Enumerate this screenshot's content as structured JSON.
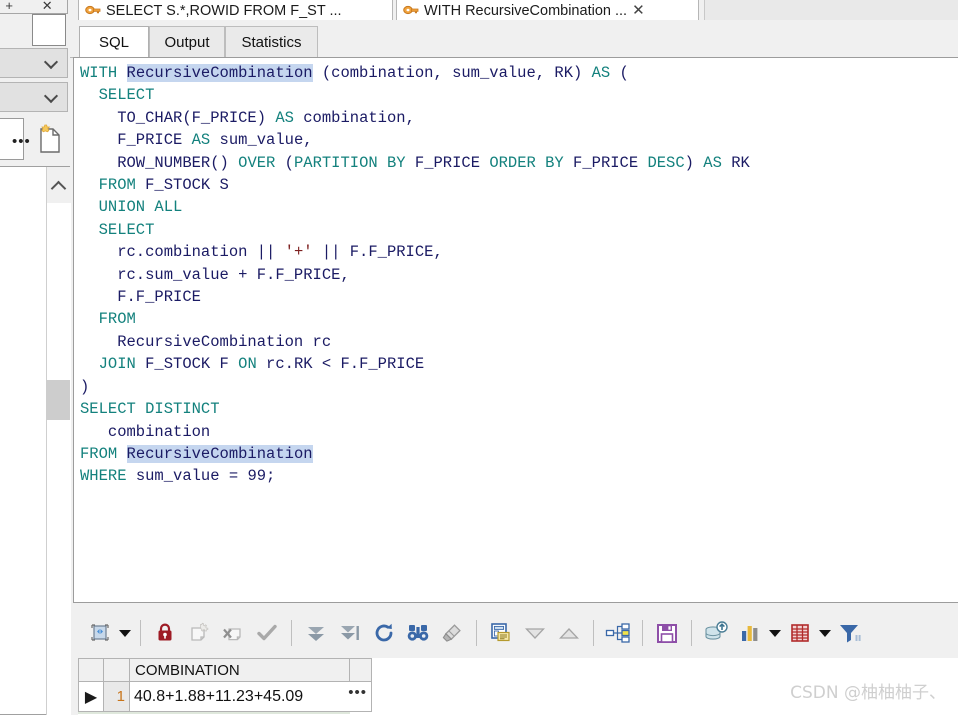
{
  "editor_tabs": [
    {
      "label": "SELECT S.*,ROWID FROM F_ST ...",
      "icon": "sql-window-icon",
      "active": false,
      "close": ""
    },
    {
      "label": "WITH RecursiveCombination  ...",
      "icon": "sql-window-icon",
      "active": true,
      "close": "✕"
    }
  ],
  "sub_tabs": [
    {
      "label": "SQL",
      "active": true
    },
    {
      "label": "Output",
      "active": false
    },
    {
      "label": "Statistics",
      "active": false
    }
  ],
  "sql": {
    "lines": [
      [
        {
          "t": "WITH ",
          "c": "kw"
        },
        {
          "t": "RecursiveCombination",
          "c": "hl"
        },
        {
          "t": " (combination, sum_value, RK) ",
          "c": "id"
        },
        {
          "t": "AS",
          "c": "kw"
        },
        {
          "t": " (",
          "c": "id"
        }
      ],
      [
        {
          "t": "  SELECT",
          "c": "kw"
        }
      ],
      [
        {
          "t": "    TO_CHAR(F_PRICE) ",
          "c": "id"
        },
        {
          "t": "AS",
          "c": "kw"
        },
        {
          "t": " combination,",
          "c": "id"
        }
      ],
      [
        {
          "t": "    F_PRICE ",
          "c": "id"
        },
        {
          "t": "AS",
          "c": "kw"
        },
        {
          "t": " sum_value,",
          "c": "id"
        }
      ],
      [
        {
          "t": "    ROW_NUMBER() ",
          "c": "id"
        },
        {
          "t": "OVER",
          "c": "kw"
        },
        {
          "t": " (",
          "c": "id"
        },
        {
          "t": "PARTITION BY",
          "c": "kw"
        },
        {
          "t": " F_PRICE ",
          "c": "id"
        },
        {
          "t": "ORDER BY",
          "c": "kw"
        },
        {
          "t": " F_PRICE ",
          "c": "id"
        },
        {
          "t": "DESC",
          "c": "kw"
        },
        {
          "t": ") ",
          "c": "id"
        },
        {
          "t": "AS",
          "c": "kw"
        },
        {
          "t": " RK",
          "c": "id"
        }
      ],
      [
        {
          "t": "  FROM",
          "c": "kw"
        },
        {
          "t": " F_STOCK S",
          "c": "id"
        }
      ],
      [
        {
          "t": "  UNION ALL",
          "c": "kw"
        }
      ],
      [
        {
          "t": "  SELECT",
          "c": "kw"
        }
      ],
      [
        {
          "t": "    rc.combination || ",
          "c": "id"
        },
        {
          "t": "'+'",
          "c": "str"
        },
        {
          "t": " || F.F_PRICE,",
          "c": "id"
        }
      ],
      [
        {
          "t": "    rc.sum_value + F.F_PRICE,",
          "c": "id"
        }
      ],
      [
        {
          "t": "    F.F_PRICE",
          "c": "id"
        }
      ],
      [
        {
          "t": "  FROM",
          "c": "kw"
        }
      ],
      [
        {
          "t": "    RecursiveCombination rc",
          "c": "id"
        }
      ],
      [
        {
          "t": "  JOIN",
          "c": "kw"
        },
        {
          "t": " F_STOCK F ",
          "c": "id"
        },
        {
          "t": "ON",
          "c": "kw"
        },
        {
          "t": " rc.RK < F.F_PRICE",
          "c": "id"
        }
      ],
      [
        {
          "t": ")",
          "c": "id"
        }
      ],
      [
        {
          "t": "SELECT DISTINCT",
          "c": "kw"
        }
      ],
      [
        {
          "t": "   combination",
          "c": "id"
        }
      ],
      [
        {
          "t": "FROM ",
          "c": "kw"
        },
        {
          "t": "RecursiveCombination",
          "c": "hl"
        }
      ],
      [
        {
          "t": "WHERE",
          "c": "kw"
        },
        {
          "t": " sum_value = ",
          "c": "id"
        },
        {
          "t": "99",
          "c": "num"
        },
        {
          "t": ";",
          "c": "id"
        }
      ]
    ]
  },
  "toolbar": {
    "buttons": [
      {
        "name": "resize-columns-button",
        "icon": "resize-grid-icon",
        "enabled": true,
        "caret": true
      },
      {
        "name": "lock-record-button",
        "icon": "padlock-icon",
        "enabled": true,
        "caret": false
      },
      {
        "name": "insert-record-button",
        "icon": "new-record-icon",
        "enabled": false,
        "caret": false
      },
      {
        "name": "delete-record-button",
        "icon": "delete-record-icon",
        "enabled": false,
        "caret": false
      },
      {
        "name": "post-changes-button",
        "icon": "checkmark-icon",
        "enabled": false,
        "caret": false
      },
      {
        "name": "fetch-next-page-button",
        "icon": "fetch-next-icon",
        "enabled": true,
        "caret": false
      },
      {
        "name": "fetch-last-page-button",
        "icon": "fetch-last-icon",
        "enabled": true,
        "caret": false
      },
      {
        "name": "refresh-button",
        "icon": "refresh-icon",
        "enabled": true,
        "caret": false
      },
      {
        "name": "find-button",
        "icon": "binoculars-icon",
        "enabled": true,
        "caret": false
      },
      {
        "name": "clear-button",
        "icon": "eraser-icon",
        "enabled": true,
        "caret": false
      },
      {
        "name": "single-record-view-button",
        "icon": "record-view-icon",
        "enabled": true,
        "caret": false
      },
      {
        "name": "previous-record-button",
        "icon": "triangle-down-icon",
        "enabled": true,
        "caret": false
      },
      {
        "name": "next-record-button",
        "icon": "triangle-up-icon",
        "enabled": true,
        "caret": false
      },
      {
        "name": "explain-plan-button",
        "icon": "hierarchy-tree-icon",
        "enabled": true,
        "caret": false
      },
      {
        "name": "save-button",
        "icon": "floppy-save-icon",
        "enabled": true,
        "caret": false
      },
      {
        "name": "export-data-button",
        "icon": "database-export-icon",
        "enabled": true,
        "caret": false
      },
      {
        "name": "chart-button",
        "icon": "bar-chart-icon",
        "enabled": true,
        "caret": true
      },
      {
        "name": "grid-options-button",
        "icon": "red-grid-icon",
        "enabled": true,
        "caret": true
      },
      {
        "name": "filter-button",
        "icon": "filter-funnel-icon",
        "enabled": true,
        "caret": false
      }
    ]
  },
  "result_grid": {
    "columns": [
      "COMBINATION"
    ],
    "rows": [
      {
        "number": "1",
        "indicator": "▶",
        "values": [
          "40.8+1.88+11.23+45.09"
        ],
        "ellipsis": "•••"
      }
    ]
  },
  "left_rail": {
    "plus_glyph": "+",
    "close_glyph": "✕",
    "overflow_dots": "•••"
  },
  "watermark": "CSDN @柚柚柚子、",
  "colors": {
    "keyword": "#13817d",
    "identifier": "#1b1b64",
    "string": "#7d2020",
    "match_highlight": "#c5d6ef",
    "row_number": "#c8741a",
    "window_bg": "#f0f0f0"
  }
}
